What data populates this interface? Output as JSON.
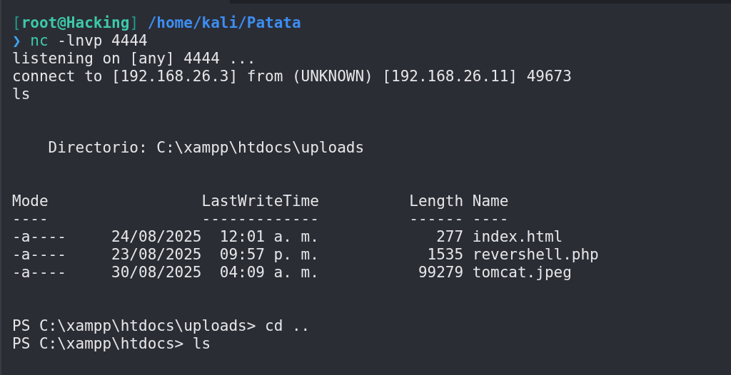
{
  "terminal": {
    "prompt": {
      "open_bracket": "[",
      "user": "root@Hacking",
      "close_bracket": "]",
      "path": "/home/kali/Patata",
      "arrow": "❯",
      "command_name": "nc",
      "command_args": "-lnvp 4444"
    },
    "output_lines": [
      "listening on [any] 4444 ...",
      "connect to [192.168.26.3] from (UNKNOWN) [192.168.26.11] 49673",
      "ls"
    ],
    "directory_line": "Directorio: C:\\xampp\\htdocs\\uploads",
    "listing": {
      "columns": [
        "Mode",
        "LastWriteTime",
        "Length",
        "Name"
      ],
      "separators": [
        "----",
        "-------------",
        "------",
        "----"
      ],
      "rows": [
        {
          "mode": "-a----",
          "date": "24/08/2025",
          "time": "12:01 a. m.",
          "length": "277",
          "name": "index.html"
        },
        {
          "mode": "-a----",
          "date": "23/08/2025",
          "time": "09:57 p. m.",
          "length": "1535",
          "name": "revershell.php"
        },
        {
          "mode": "-a----",
          "date": "30/08/2025",
          "time": "04:09 a. m.",
          "length": "99279",
          "name": "tomcat.jpeg"
        }
      ]
    },
    "ps_lines": [
      {
        "prompt": "PS C:\\xampp\\htdocs\\uploads>",
        "command": "cd .."
      },
      {
        "prompt": "PS C:\\xampp\\htdocs>",
        "command": "ls"
      }
    ]
  }
}
